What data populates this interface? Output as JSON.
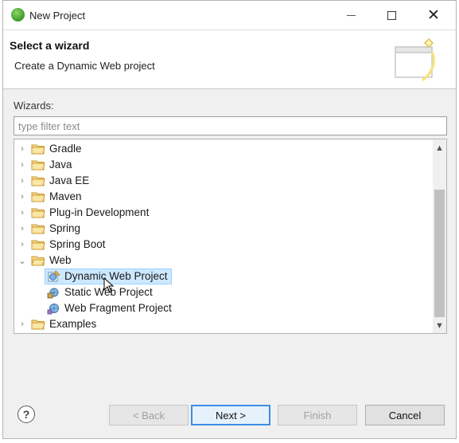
{
  "window": {
    "title": "New Project",
    "accent": "#3c8ee6"
  },
  "header": {
    "title": "Select a wizard",
    "description": "Create a Dynamic Web project"
  },
  "wizards": {
    "label": "Wizards:",
    "filter_placeholder": "type filter text"
  },
  "tree": {
    "items": [
      {
        "label": "Gradle",
        "expanded": false
      },
      {
        "label": "Java",
        "expanded": false
      },
      {
        "label": "Java EE",
        "expanded": false
      },
      {
        "label": "Maven",
        "expanded": false
      },
      {
        "label": "Plug-in Development",
        "expanded": false
      },
      {
        "label": "Spring",
        "expanded": false
      },
      {
        "label": "Spring Boot",
        "expanded": false
      },
      {
        "label": "Web",
        "expanded": true
      },
      {
        "label": "Dynamic Web Project",
        "selected": true
      },
      {
        "label": "Static Web Project"
      },
      {
        "label": "Web Fragment Project"
      },
      {
        "label": "Examples",
        "expanded": false
      }
    ]
  },
  "buttons": {
    "help": "?",
    "back": "< Back",
    "next": "Next >",
    "finish": "Finish",
    "cancel": "Cancel"
  }
}
